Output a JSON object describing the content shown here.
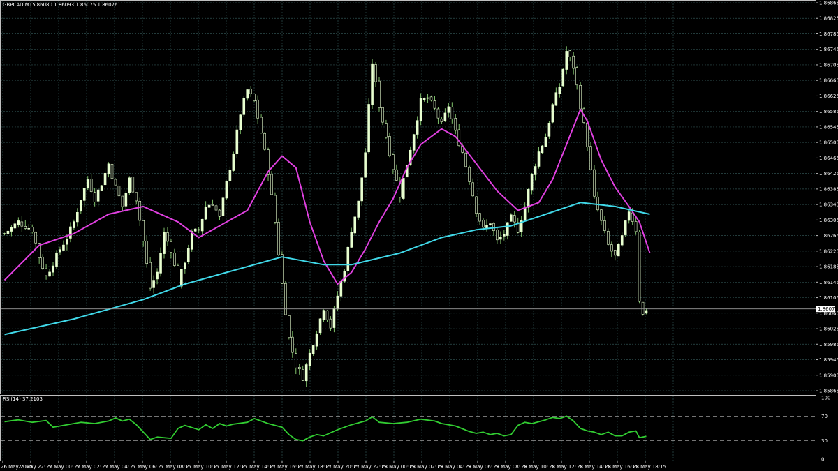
{
  "header": {
    "symbol": "GBPCAD,M15",
    "ohlc": "1.86080 1.86093 1.86075 1.86076"
  },
  "rsi_header": "RSI(14) 37.2103",
  "price_tag": "1.86076",
  "colors": {
    "background": "#000000",
    "grid": "#2f4f4f",
    "candle": "#e8ffd0",
    "wick": "#7fbf6a",
    "ma_fast": "#e040e0",
    "ma_slow": "#40d8e8",
    "rsi_line": "#32cd32",
    "axis_text": "#ffffff"
  },
  "chart_data": [
    {
      "type": "candlestick",
      "title": "GBPCAD,M15",
      "ylim": [
        1.85865,
        1.86865
      ],
      "y_ticks": [
        "1.86865",
        "1.86825",
        "1.86785",
        "1.86745",
        "1.86705",
        "1.86665",
        "1.86625",
        "1.86585",
        "1.86545",
        "1.86505",
        "1.86465",
        "1.86425",
        "1.86385",
        "1.86345",
        "1.86305",
        "1.86265",
        "1.86225",
        "1.86185",
        "1.86145",
        "1.86105",
        "1.86065",
        "1.86025",
        "1.85985",
        "1.85945",
        "1.85905",
        "1.85865"
      ],
      "x_ticks": [
        "26 May 2025",
        "26 May 22:15",
        "27 May 00:15",
        "27 May 02:15",
        "27 May 04:15",
        "27 May 06:15",
        "27 May 08:15",
        "27 May 10:15",
        "27 May 12:15",
        "27 May 14:15",
        "27 May 16:15",
        "27 May 18:15",
        "27 May 20:15",
        "27 May 22:15",
        "28 May 00:15",
        "28 May 02:15",
        "28 May 04:15",
        "28 May 06:15",
        "28 May 08:15",
        "28 May 10:15",
        "28 May 12:15",
        "28 May 14:15",
        "28 May 16:15",
        "28 May 18:15"
      ],
      "close_path": [
        [
          0,
          1.8627
        ],
        [
          4,
          1.863
        ],
        [
          8,
          1.8628
        ],
        [
          10,
          1.8621
        ],
        [
          12,
          1.8616
        ],
        [
          16,
          1.8623
        ],
        [
          18,
          1.8626
        ],
        [
          20,
          1.863
        ],
        [
          22,
          1.8636
        ],
        [
          24,
          1.8641
        ],
        [
          26,
          1.8636
        ],
        [
          28,
          1.864
        ],
        [
          30,
          1.8645
        ],
        [
          32,
          1.8639
        ],
        [
          34,
          1.8634
        ],
        [
          36,
          1.8641
        ],
        [
          38,
          1.8636
        ],
        [
          40,
          1.8625
        ],
        [
          42,
          1.8613
        ],
        [
          44,
          1.8617
        ],
        [
          46,
          1.8627
        ],
        [
          48,
          1.8623
        ],
        [
          50,
          1.8614
        ],
        [
          52,
          1.862
        ],
        [
          54,
          1.8627
        ],
        [
          56,
          1.8628
        ],
        [
          58,
          1.8634
        ],
        [
          60,
          1.8635
        ],
        [
          62,
          1.8631
        ],
        [
          64,
          1.864
        ],
        [
          66,
          1.8648
        ],
        [
          68,
          1.8658
        ],
        [
          70,
          1.8664
        ],
        [
          72,
          1.8661
        ],
        [
          74,
          1.8653
        ],
        [
          76,
          1.8643
        ],
        [
          78,
          1.863
        ],
        [
          80,
          1.8614
        ],
        [
          82,
          1.86
        ],
        [
          84,
          1.8593
        ],
        [
          86,
          1.859
        ],
        [
          88,
          1.8596
        ],
        [
          90,
          1.8602
        ],
        [
          92,
          1.8608
        ],
        [
          94,
          1.8603
        ],
        [
          96,
          1.8611
        ],
        [
          98,
          1.8618
        ],
        [
          100,
          1.8628
        ],
        [
          102,
          1.8635
        ],
        [
          104,
          1.8648
        ],
        [
          106,
          1.8671
        ],
        [
          108,
          1.866
        ],
        [
          110,
          1.8652
        ],
        [
          112,
          1.8644
        ],
        [
          114,
          1.8637
        ],
        [
          116,
          1.8645
        ],
        [
          118,
          1.8653
        ],
        [
          120,
          1.8661
        ],
        [
          122,
          1.8662
        ],
        [
          124,
          1.8659
        ],
        [
          126,
          1.8655
        ],
        [
          128,
          1.866
        ],
        [
          130,
          1.8653
        ],
        [
          132,
          1.8648
        ],
        [
          134,
          1.8641
        ],
        [
          136,
          1.8633
        ],
        [
          138,
          1.8628
        ],
        [
          140,
          1.863
        ],
        [
          142,
          1.8625
        ],
        [
          144,
          1.8627
        ],
        [
          146,
          1.8631
        ],
        [
          148,
          1.8628
        ],
        [
          150,
          1.8634
        ],
        [
          152,
          1.8642
        ],
        [
          154,
          1.8648
        ],
        [
          156,
          1.8652
        ],
        [
          158,
          1.866
        ],
        [
          160,
          1.8665
        ],
        [
          162,
          1.8674
        ],
        [
          164,
          1.867
        ],
        [
          166,
          1.866
        ],
        [
          168,
          1.865
        ],
        [
          170,
          1.8636
        ],
        [
          172,
          1.863
        ],
        [
          174,
          1.8624
        ],
        [
          176,
          1.8621
        ],
        [
          178,
          1.8626
        ],
        [
          180,
          1.8633
        ],
        [
          182,
          1.8628
        ],
        [
          183,
          1.861
        ],
        [
          184,
          1.8606
        ],
        [
          185,
          1.86076
        ]
      ],
      "series": [
        {
          "name": "",
          "color": "#e040e0",
          "points": [
            [
              0,
              1.8615
            ],
            [
              10,
              1.8624
            ],
            [
              20,
              1.8627
            ],
            [
              30,
              1.8632
            ],
            [
              40,
              1.8634
            ],
            [
              50,
              1.863
            ],
            [
              56,
              1.8626
            ],
            [
              64,
              1.863
            ],
            [
              70,
              1.8633
            ],
            [
              76,
              1.8643
            ],
            [
              80,
              1.8647
            ],
            [
              84,
              1.8644
            ],
            [
              88,
              1.863
            ],
            [
              92,
              1.862
            ],
            [
              96,
              1.8614
            ],
            [
              100,
              1.8617
            ],
            [
              104,
              1.8623
            ],
            [
              108,
              1.863
            ],
            [
              112,
              1.8636
            ],
            [
              116,
              1.8644
            ],
            [
              120,
              1.865
            ],
            [
              126,
              1.8654
            ],
            [
              130,
              1.8652
            ],
            [
              136,
              1.8645
            ],
            [
              142,
              1.8638
            ],
            [
              148,
              1.8633
            ],
            [
              154,
              1.8635
            ],
            [
              158,
              1.8641
            ],
            [
              162,
              1.865
            ],
            [
              166,
              1.8659
            ],
            [
              168,
              1.8656
            ],
            [
              172,
              1.8646
            ],
            [
              176,
              1.8639
            ],
            [
              180,
              1.8634
            ],
            [
              183,
              1.863
            ],
            [
              186,
              1.8622
            ]
          ]
        },
        {
          "name": "",
          "color": "#40d8e8",
          "points": [
            [
              0,
              1.8601
            ],
            [
              20,
              1.8605
            ],
            [
              40,
              1.861
            ],
            [
              52,
              1.8614
            ],
            [
              64,
              1.8617
            ],
            [
              80,
              1.8621
            ],
            [
              92,
              1.8619
            ],
            [
              100,
              1.8619
            ],
            [
              114,
              1.8622
            ],
            [
              126,
              1.8626
            ],
            [
              136,
              1.8628
            ],
            [
              146,
              1.8629
            ],
            [
              156,
              1.8632
            ],
            [
              166,
              1.8635
            ],
            [
              176,
              1.8634
            ],
            [
              186,
              1.8632
            ]
          ]
        }
      ]
    },
    {
      "type": "line",
      "title": "RSI(14) 37.2103",
      "ylim": [
        0,
        100
      ],
      "y_ticks": [
        "100",
        "70",
        "30",
        "0"
      ],
      "levels": [
        70,
        30
      ],
      "series": [
        {
          "name": "RSI(14)",
          "color": "#32cd32",
          "points": [
            [
              0,
              61
            ],
            [
              4,
              64
            ],
            [
              8,
              60
            ],
            [
              12,
              63
            ],
            [
              14,
              52
            ],
            [
              18,
              56
            ],
            [
              22,
              60
            ],
            [
              26,
              58
            ],
            [
              30,
              62
            ],
            [
              32,
              67
            ],
            [
              34,
              62
            ],
            [
              36,
              65
            ],
            [
              38,
              56
            ],
            [
              40,
              44
            ],
            [
              42,
              32
            ],
            [
              44,
              36
            ],
            [
              48,
              34
            ],
            [
              50,
              50
            ],
            [
              52,
              55
            ],
            [
              56,
              48
            ],
            [
              58,
              56
            ],
            [
              60,
              50
            ],
            [
              62,
              58
            ],
            [
              64,
              54
            ],
            [
              66,
              57
            ],
            [
              70,
              60
            ],
            [
              72,
              66
            ],
            [
              76,
              58
            ],
            [
              80,
              52
            ],
            [
              82,
              40
            ],
            [
              84,
              32
            ],
            [
              86,
              30
            ],
            [
              88,
              36
            ],
            [
              90,
              40
            ],
            [
              92,
              38
            ],
            [
              96,
              48
            ],
            [
              100,
              56
            ],
            [
              104,
              62
            ],
            [
              106,
              69
            ],
            [
              108,
              60
            ],
            [
              112,
              58
            ],
            [
              116,
              60
            ],
            [
              120,
              65
            ],
            [
              124,
              62
            ],
            [
              126,
              58
            ],
            [
              130,
              54
            ],
            [
              134,
              45
            ],
            [
              136,
              42
            ],
            [
              138,
              44
            ],
            [
              140,
              40
            ],
            [
              142,
              42
            ],
            [
              144,
              38
            ],
            [
              146,
              40
            ],
            [
              148,
              55
            ],
            [
              150,
              60
            ],
            [
              152,
              58
            ],
            [
              156,
              64
            ],
            [
              158,
              68
            ],
            [
              160,
              66
            ],
            [
              162,
              70
            ],
            [
              164,
              62
            ],
            [
              166,
              50
            ],
            [
              168,
              46
            ],
            [
              170,
              44
            ],
            [
              172,
              40
            ],
            [
              174,
              44
            ],
            [
              176,
              38
            ],
            [
              178,
              38
            ],
            [
              180,
              44
            ],
            [
              182,
              46
            ],
            [
              183,
              35
            ],
            [
              184,
              36
            ],
            [
              185,
              37.2
            ]
          ]
        }
      ]
    }
  ]
}
